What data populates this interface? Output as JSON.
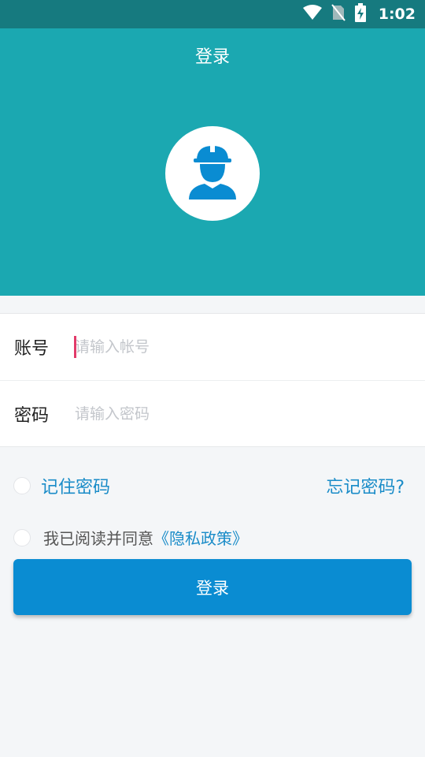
{
  "status_bar": {
    "time": "1:02",
    "icons": [
      "wifi-icon",
      "no-sim-icon",
      "battery-charging-icon"
    ]
  },
  "header": {
    "title": "登录",
    "avatar_icon": "worker-helmet-icon",
    "background_color": "#1ba8b1"
  },
  "form": {
    "account": {
      "label": "账号",
      "placeholder": "请输入帐号",
      "value": ""
    },
    "password": {
      "label": "密码",
      "placeholder": "请输入密码",
      "value": ""
    }
  },
  "options": {
    "remember_label": "记住密码",
    "forgot_label": "忘记密码?",
    "agree_prefix": "我已阅读并同意",
    "privacy_link": "《隐私政策》"
  },
  "login_button": {
    "label": "登录",
    "color": "#0a8cd2"
  },
  "accent_color": "#1a8cc8"
}
